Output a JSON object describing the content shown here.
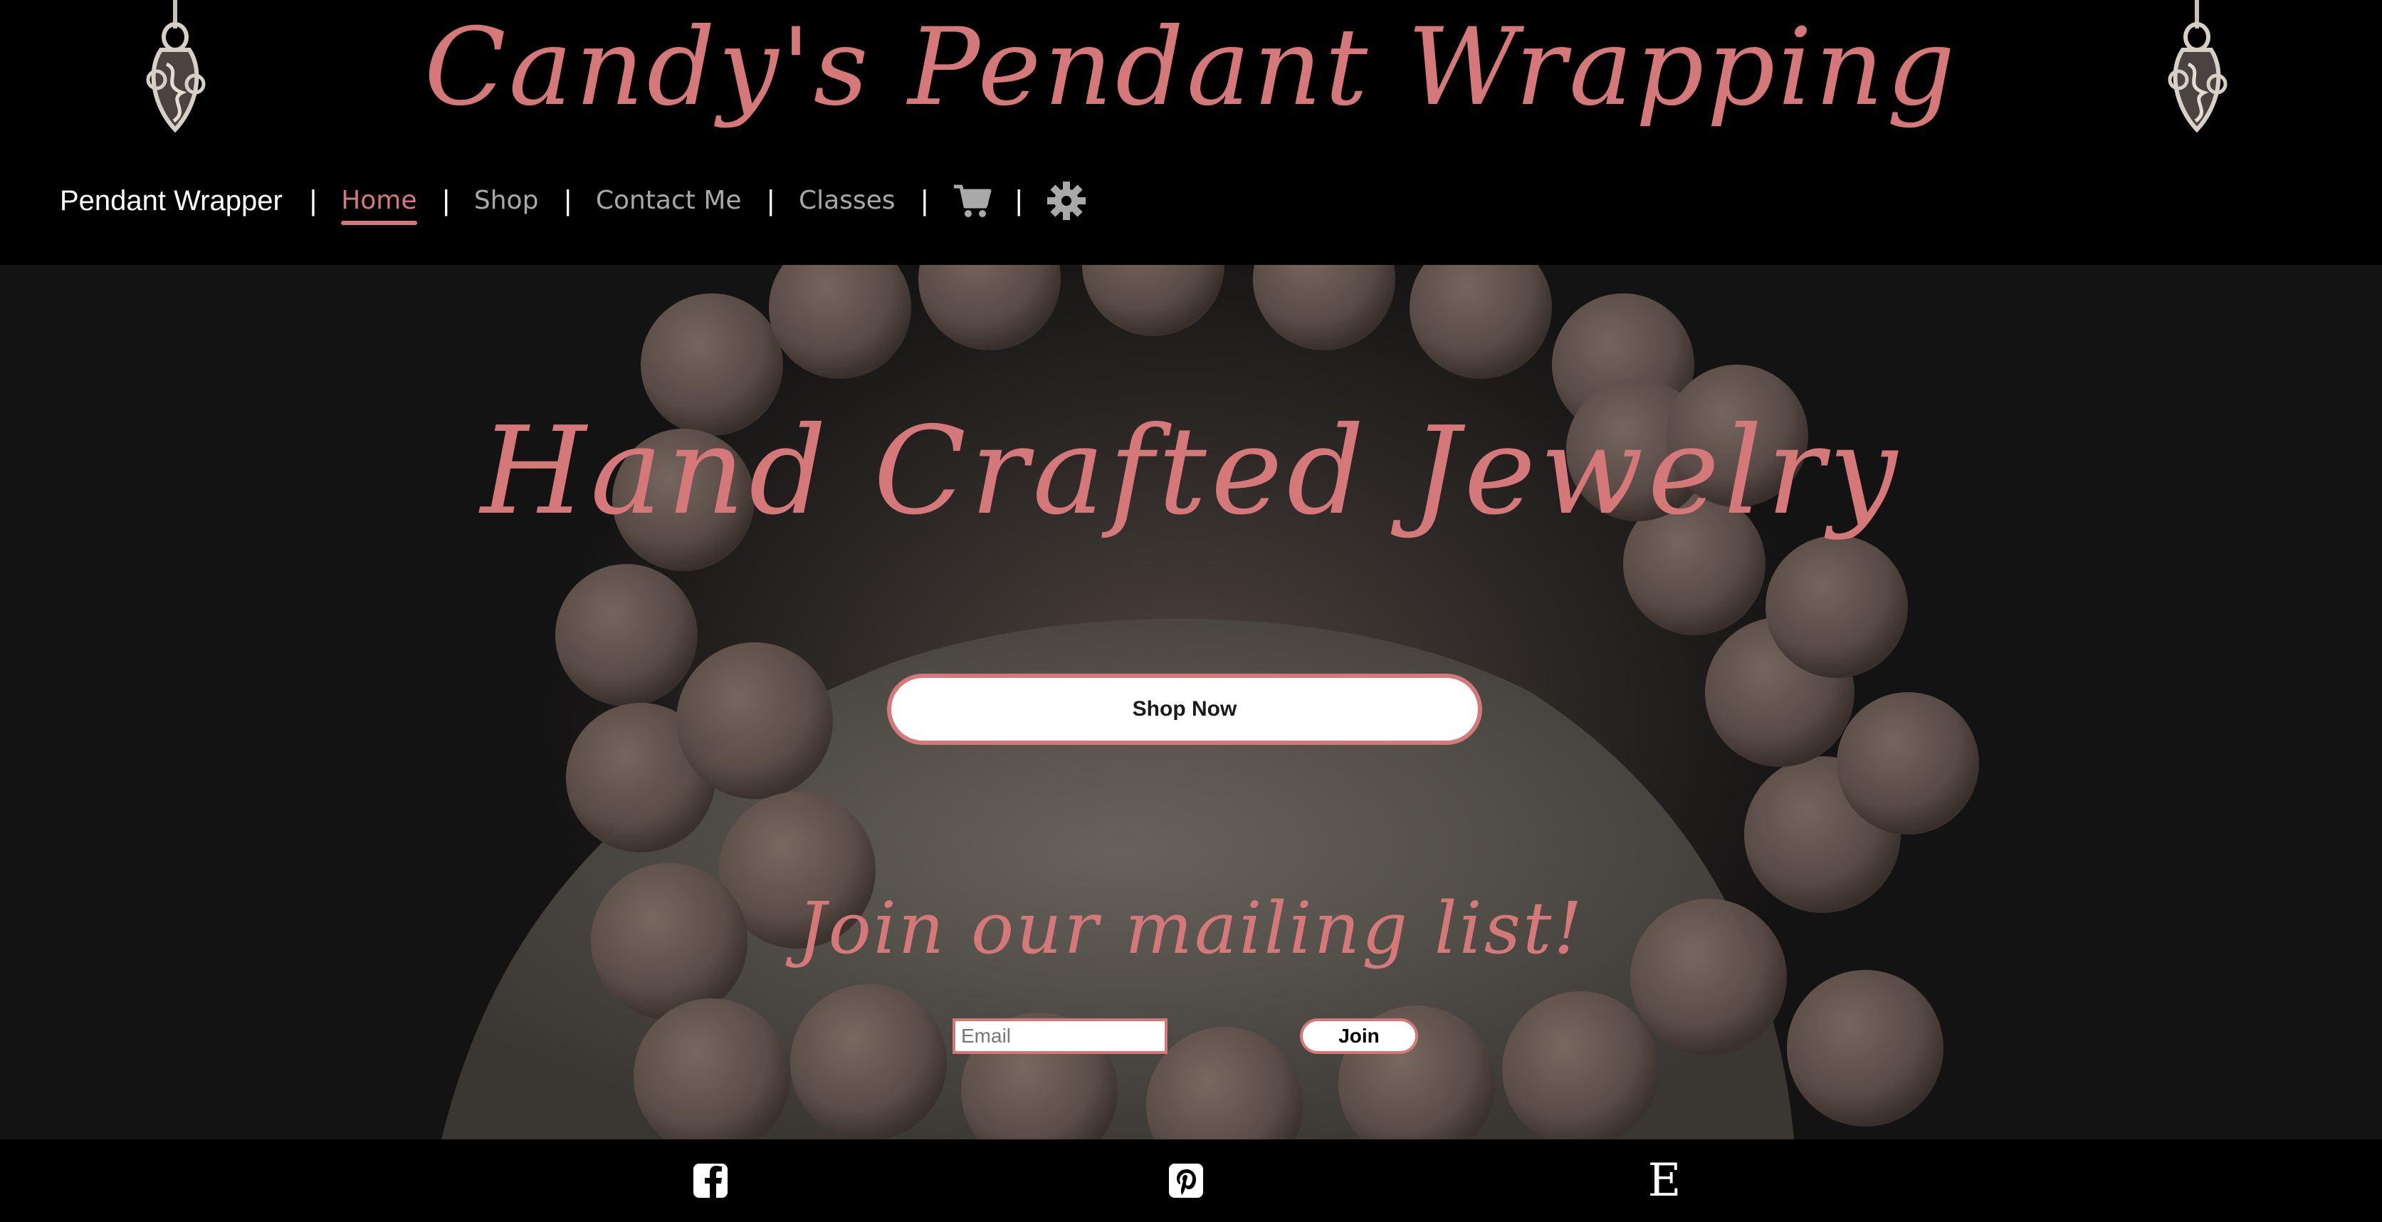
{
  "header": {
    "site_title": "Candy's Pendant Wrapping",
    "brand": "Pendant Wrapper",
    "separator": "|",
    "nav": [
      {
        "label": "Home",
        "active": true
      },
      {
        "label": "Shop",
        "active": false
      },
      {
        "label": "Contact Me",
        "active": false
      },
      {
        "label": "Classes",
        "active": false
      }
    ],
    "icons": [
      "cart-icon",
      "gear-icon"
    ]
  },
  "hero": {
    "title": "Hand Crafted Jewelry",
    "shop_button": "Shop Now",
    "mailing_title": "Join our mailing list!",
    "email_placeholder": "Email",
    "join_button": "Join"
  },
  "footer": {
    "social_icons": [
      "facebook-icon",
      "pinterest-icon",
      "etsy-icon"
    ],
    "etsy_glyph": "E"
  },
  "colors": {
    "accent": "#d4787a",
    "background": "#000000",
    "nav_text": "#a9a9a9"
  }
}
